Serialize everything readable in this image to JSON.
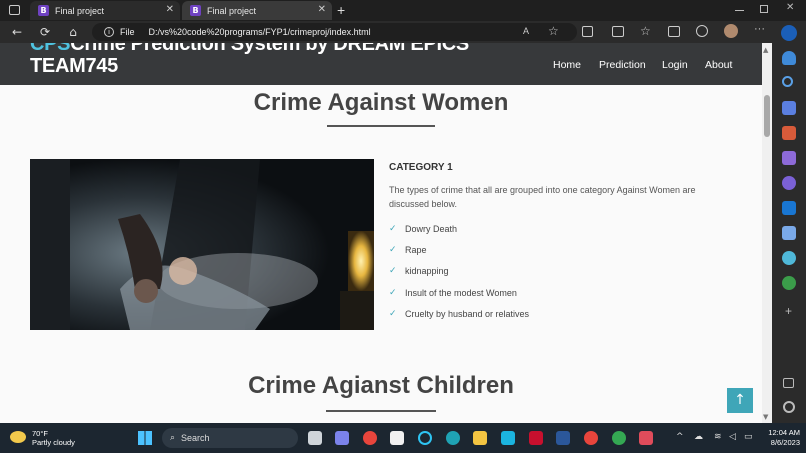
{
  "browser": {
    "tabs": [
      {
        "favicon": "B",
        "title": "Final project"
      },
      {
        "favicon": "B",
        "title": "Final project"
      }
    ],
    "address": {
      "scheme_label": "File",
      "url": "D:/vs%20code%20programs/FYP1/crimeproj/index.html"
    },
    "icons": {
      "back": "←",
      "refresh": "⟳",
      "home": "⌂",
      "new_tab": "+",
      "more": "···",
      "info": "i",
      "tab_close": "✕"
    }
  },
  "site": {
    "brand_prefix": "CPS",
    "brand_rest": "Crime Prediction System by DREAM EPICS TEAM745",
    "nav": [
      "Home",
      "Prediction",
      "Login",
      "About"
    ]
  },
  "women_section": {
    "heading": "Crime Against Women",
    "category": "CATEGORY 1",
    "description": "The types of crime that all are grouped into one category Against Women are discussed below.",
    "items": [
      "Dowry Death",
      "Rape",
      "kidnapping",
      "Insult of the modest Women",
      "Cruelty by husband or relatives"
    ]
  },
  "children_section": {
    "heading": "Crime Agianst Children"
  },
  "back_to_top": "↑",
  "check_glyph": "✓",
  "taskbar": {
    "weather_temp": "70°F",
    "weather_desc": "Partly cloudy",
    "search_label": "Search",
    "time": "12:04 AM",
    "date": "8/6/2023"
  },
  "colors": {
    "accent": "#3fa6b8",
    "brand_cps": "#4fc3e0",
    "header_bg": "#37393b"
  }
}
